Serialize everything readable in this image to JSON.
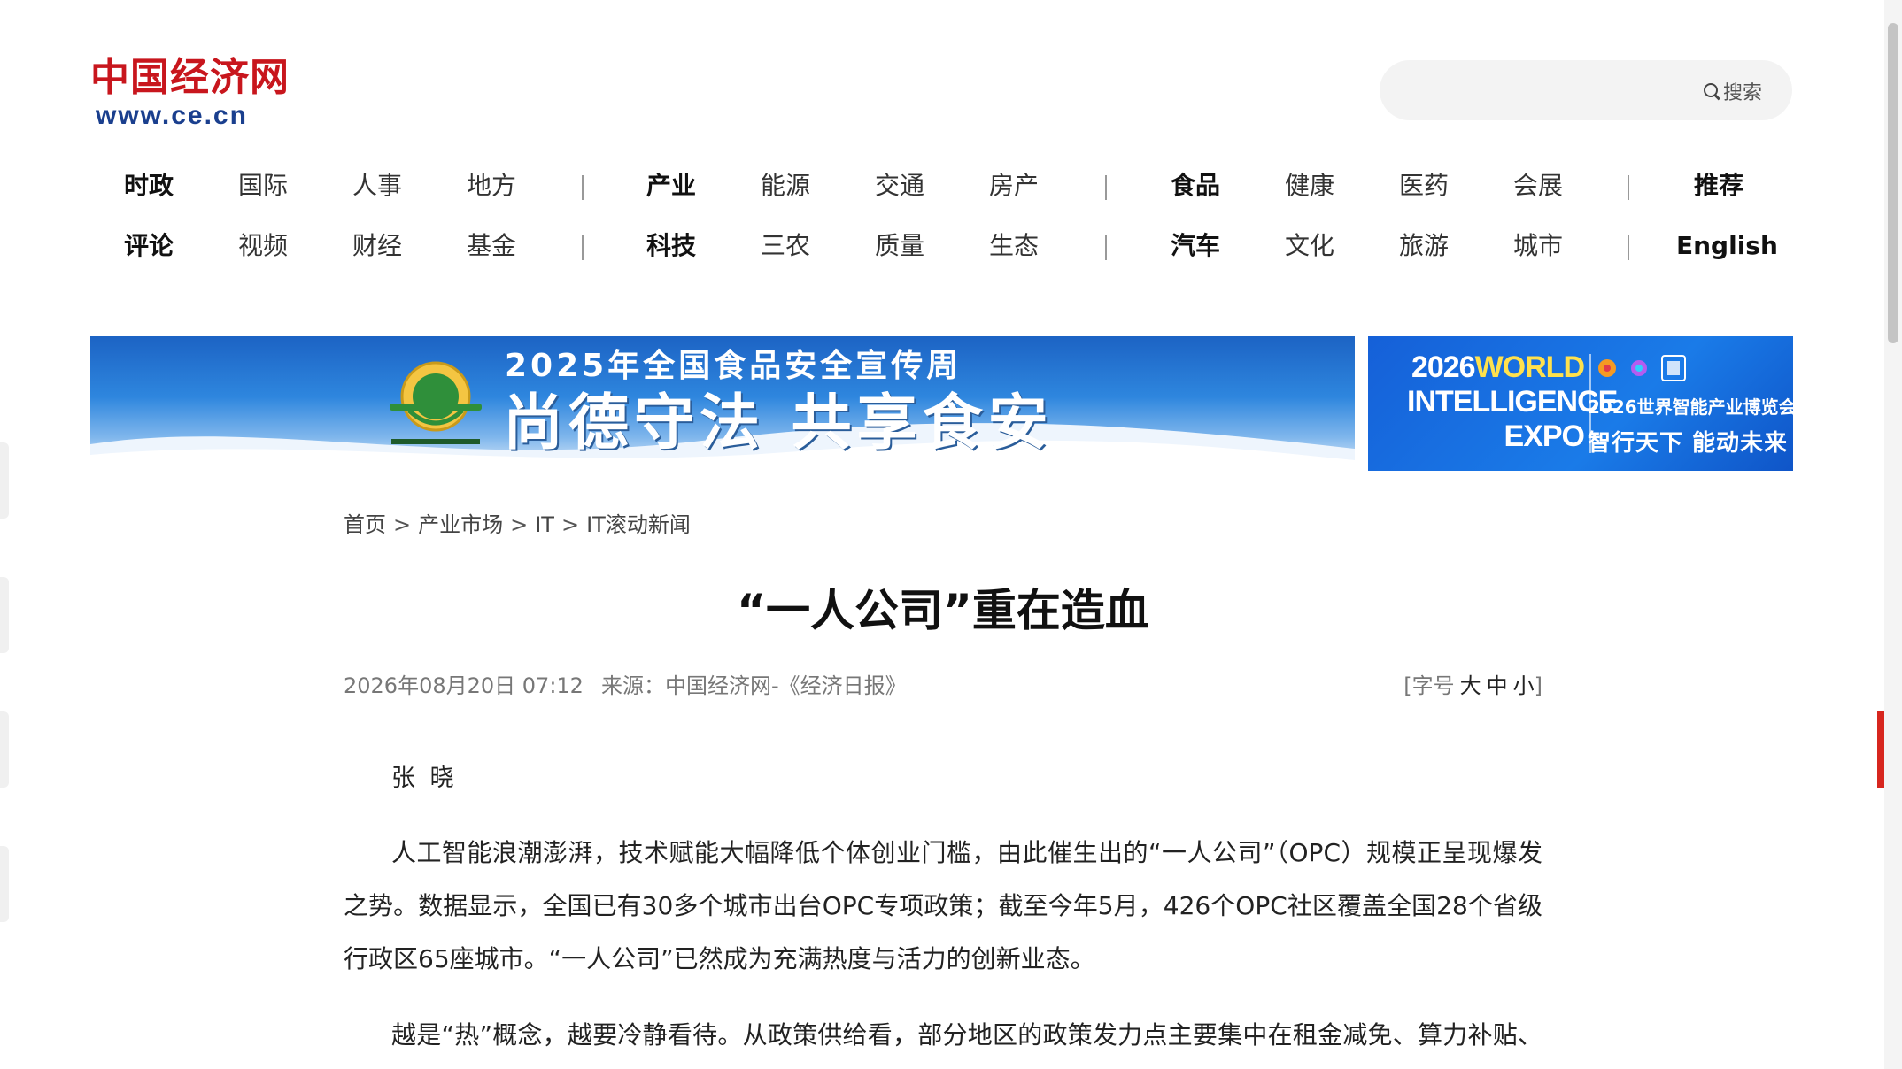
{
  "header": {
    "logo_cn": "中国经济网",
    "logo_url": "www.ce.cn",
    "search": {
      "placeholder": "",
      "button_label": "搜索"
    }
  },
  "nav": {
    "row1": [
      "时政",
      "国际",
      "人事",
      "地方",
      "产业",
      "能源",
      "交通",
      "房产",
      "食品",
      "健康",
      "医药",
      "会展",
      "推荐"
    ],
    "row2": [
      "评论",
      "视频",
      "财经",
      "基金",
      "科技",
      "三农",
      "质量",
      "生态",
      "汽车",
      "文化",
      "旅游",
      "城市",
      "English"
    ]
  },
  "banners": {
    "food": {
      "subtitle": "2025年全国食品安全宣传周",
      "main": "尚德守法  共享食安"
    },
    "expo": {
      "year": "2026",
      "line1": "WORLD",
      "line2": "INTELLIGENCE",
      "line3": "EXPO",
      "cn_title": "2026世界智能产业博览会",
      "slogan": "智行天下 能动未来"
    }
  },
  "breadcrumb": [
    "首页",
    "产业市场",
    "IT",
    "IT滚动新闻"
  ],
  "article": {
    "title": "“一人公司”重在造血",
    "datetime": "2026年08月20日 07:12",
    "source": "来源：中国经济网-《经济日报》",
    "fontsize": {
      "label": "[字号",
      "large": "大",
      "medium": "中",
      "small": "小",
      "close": "]"
    },
    "author": "张 晓",
    "paragraphs": [
      "人工智能浪潮澎湃，技术赋能大幅降低个体创业门槛，由此催生出的“一人公司”（OPC）规模正呈现爆发之势。数据显示，全国已有30多个城市出台OPC专项政策；截至今年5月，426个OPC社区覆盖全国28个省级行政区65座城市。“一人公司”已然成为充满热度与活力的创新业态。",
      "越是“热”概念，越要冷静看待。从政策供给看，部分地区的政策发力点主要集中在租金减免、算力补贴、注"
    ]
  },
  "colors": {
    "brand_red": "#c8161d",
    "brand_blue": "#1a3f8e",
    "expo_yellow": "#ffe14d"
  }
}
